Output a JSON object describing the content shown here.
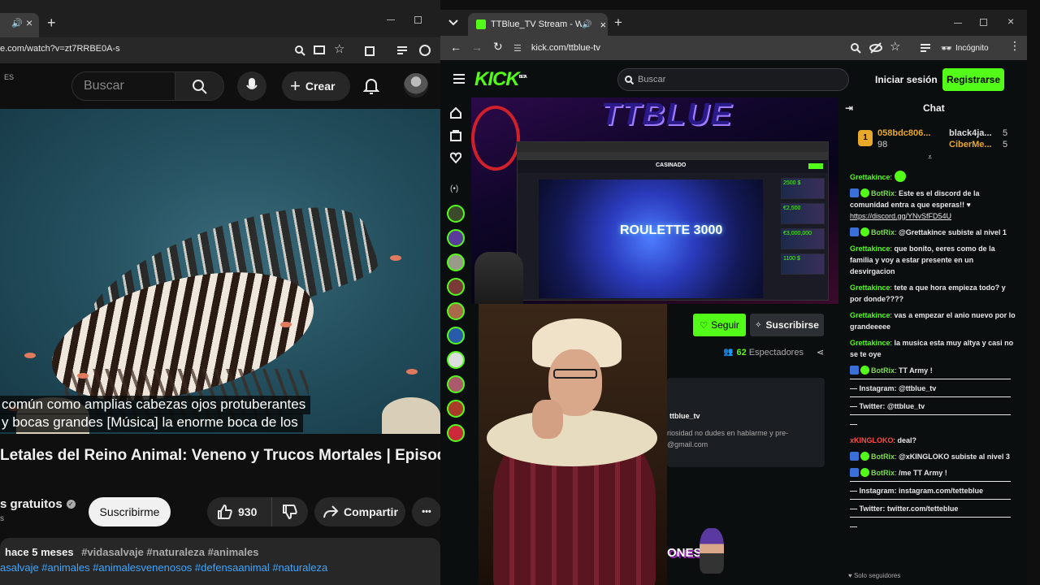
{
  "youtube": {
    "tab_close": "×",
    "tab_new": "+",
    "url": "e.com/watch?v=zt7RRBE0A-s",
    "country": "ES",
    "search_placeholder": "Buscar",
    "create_label": "Crear",
    "captions": [
      "común como amplias cabezas ojos protuberantes",
      "y bocas grandes [Música] la enorme boca de los"
    ],
    "title": "Letales del Reino Animal: Veneno y Trucos Mortales | Episodio",
    "channel": "s gratuitos",
    "channel_sub": "s",
    "subscribe": "Suscribirme",
    "likes": "930",
    "share": "Compartir",
    "more": "•••",
    "posted": "hace 5 meses",
    "tags1": "#vidasalvaje #naturaleza #animales",
    "tags2": "asalvaje #animales #animalesvenenosos #defensaanimal #naturaleza"
  },
  "kick": {
    "tab_title": "TTBlue_TV Stream - Watch",
    "tab_new": "+",
    "url": "kick.com/ttblue-tv",
    "incognito": "Incógnito",
    "logo": "KICK",
    "logo_beta": "BETA",
    "search_placeholder": "Buscar",
    "login": "Iniciar sesión",
    "register": "Registrarse",
    "banner": "TTBLUE",
    "roulette_title": "ROULETTE 3000",
    "inner_brand": "CASINADO",
    "thumb_values": [
      "2500 $",
      "€2,500",
      "€3,000,000",
      "1100 $"
    ],
    "follow": "Seguir",
    "subscribe": "Suscribirse",
    "viewers_count": "62",
    "viewers_label": "Espectadores",
    "about_name": "ttblue_tv",
    "about_text": "riosidad no dudes en hablarme y pre-",
    "about_email": "@gmail.com",
    "overlay_text": "ONES",
    "chat_title": "Chat",
    "pinned": [
      {
        "rank": "1",
        "name": "058bdc806...",
        "count": "98"
      },
      {
        "name": "black4ja...",
        "count": "5"
      },
      {
        "name": "CiberMe...",
        "count": "5"
      }
    ],
    "messages": [
      {
        "user": "Grettakince",
        "text": " ",
        "bot": false
      },
      {
        "user": "BotRix",
        "text": "Este es el discord de la comunidad entra a que esperas!! ♥",
        "link": "https://discord.gg/YNvSfFD54U",
        "bot": true
      },
      {
        "user": "BotRix",
        "text": "@Grettakince subiste al nivel 1",
        "bot": true
      },
      {
        "user": "Grettakince",
        "text": "que bonito, eeres como de la familia y voy a estar presente en un desvirgacion",
        "bot": false
      },
      {
        "user": "Grettakince",
        "text": "tete a que hora empieza todo? y por donde????",
        "bot": false
      },
      {
        "user": "Grettakince",
        "text": "vas a empezar el anio nuevo por lo grandeeeee",
        "bot": false
      },
      {
        "user": "Grettakince",
        "text": "la musica esta muy altya y casi no se te oye",
        "bot": false
      },
      {
        "user": "BotRix",
        "text": "TT Army !",
        "bot": true
      }
    ],
    "lines1": [
      "— Instagram: @ttblue_tv",
      "— Twitter: @ttblue_tv",
      "—"
    ],
    "messages2": [
      {
        "user": "xKINGLOKO",
        "text": "deal?",
        "bot": false
      },
      {
        "user": "BotRix",
        "text": "@xKINGLOKO subiste al nivel 3",
        "bot": true
      },
      {
        "user": "BotRix",
        "text": "/me TT Army !",
        "bot": true
      }
    ],
    "lines2": [
      "— Instagram: instagram.com/tetteblue",
      "— Twitter: twitter.com/tetteblue",
      "—"
    ],
    "footer": "♥ Solo seguidores"
  }
}
